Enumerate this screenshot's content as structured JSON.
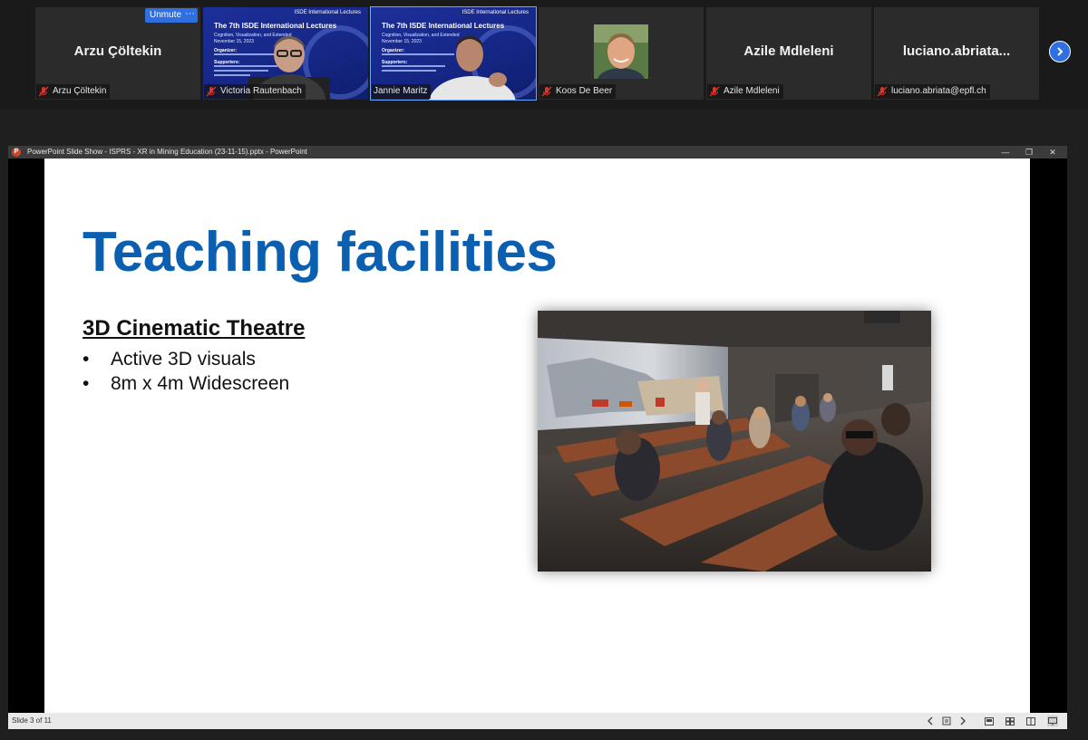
{
  "participants": [
    {
      "display_name": "Arzu Çöltekin",
      "label": "Arzu Çöltekin",
      "muted": true,
      "video": false
    },
    {
      "display_name": "",
      "label": "Victoria Rautenbach",
      "muted": true,
      "video": true
    },
    {
      "display_name": "",
      "label": "Jannie Maritz",
      "muted": false,
      "video": true
    },
    {
      "display_name": "",
      "label": "Koos De Beer",
      "muted": true,
      "video": false
    },
    {
      "display_name": "Azile Mdleleni",
      "label": "Azile Mdleleni",
      "muted": true,
      "video": false
    },
    {
      "display_name": "luciano.abriata...",
      "label": "luciano.abriata@epfl.ch",
      "muted": true,
      "video": false
    }
  ],
  "tile_overlay": {
    "unmute_label": "Unmute",
    "more_label": "···"
  },
  "thumb_slide": {
    "brand": "ISDE International Lectures",
    "title": "The 7th ISDE International Lectures",
    "subtitle": "Cognition, Visualization, and Extended",
    "date": "November 15, 2023",
    "organizer_label": "Organizer:",
    "supporters_label": "Supporters:"
  },
  "ppt": {
    "window_title": "PowerPoint Slide Show  -  ISPRS - XR in Mining Education (23-11-15).pptx - PowerPoint",
    "app_icon_letter": "P",
    "controls": {
      "minimize": "—",
      "restore": "❐",
      "close": "✕"
    },
    "slide_counter": "Slide 3 of 11"
  },
  "slide": {
    "title": "Teaching facilities",
    "section_heading": "3D Cinematic Theatre",
    "bullets": [
      {
        "marker": "•",
        "text": "Active 3D visuals"
      },
      {
        "marker": "•",
        "text": "8m x 4m Widescreen"
      }
    ]
  },
  "colors": {
    "accent_blue": "#2f6fe0",
    "slide_title_blue": "#0b5fb0",
    "mute_red": "#d9352b"
  }
}
